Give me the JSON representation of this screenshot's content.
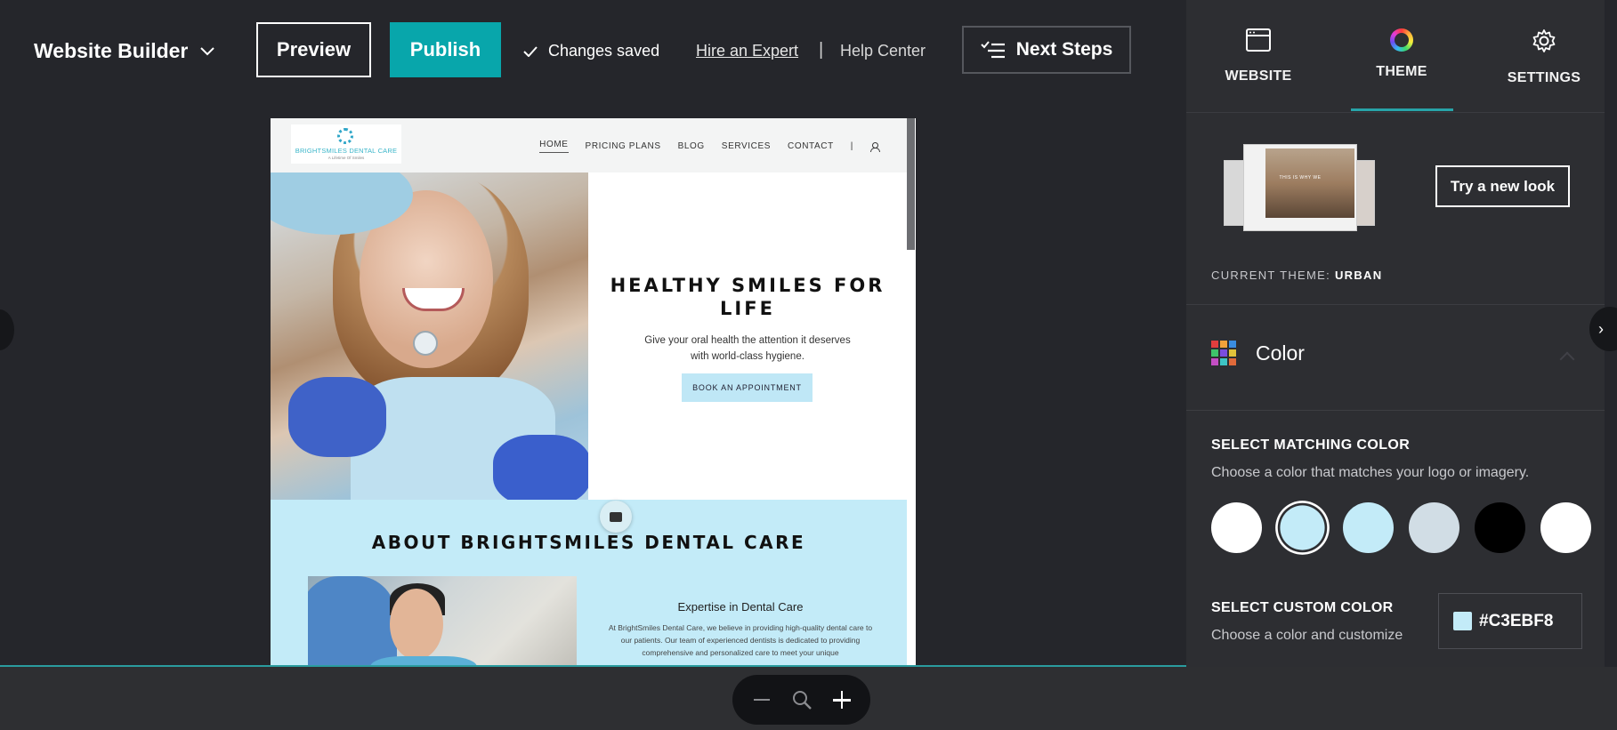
{
  "topbar": {
    "app_name": "Website Builder",
    "preview_label": "Preview",
    "publish_label": "Publish",
    "saved_status": "Changes saved",
    "hire_link": "Hire an Expert",
    "separator": "|",
    "help_link": "Help Center",
    "next_steps_label": "Next Steps"
  },
  "colors": {
    "background": "#25262b",
    "panel": "#2d2e32",
    "accent_teal": "#08a6ab",
    "tab_underline": "#27a3a8",
    "selected_custom": "#C3EBF8"
  },
  "site": {
    "logo_name": "BRIGHTSMILES DENTAL CARE",
    "logo_tagline": "A Lifetime Of Smiles",
    "menu": [
      "HOME",
      "PRICING PLANS",
      "BLOG",
      "SERVICES",
      "CONTACT"
    ],
    "menu_divider": "|",
    "hero": {
      "title": "HEALTHY SMILES FOR LIFE",
      "subtitle": "Give your oral health the attention it deserves with world-class hygiene.",
      "cta": "BOOK AN APPOINTMENT"
    },
    "about": {
      "title": "ABOUT BRIGHTSMILES DENTAL CARE",
      "heading": "Expertise in Dental Care",
      "body": "At BrightSmiles Dental Care, we believe in providing high-quality dental care to our patients. Our team of experienced dentists is dedicated to providing comprehensive and personalized care to meet your unique"
    }
  },
  "zoom": {
    "minus_icon": "minus-icon",
    "search_icon": "zoom-icon",
    "plus_icon": "plus-icon"
  },
  "panel": {
    "tabs": [
      {
        "label": "WEBSITE",
        "icon": "browser-window-icon"
      },
      {
        "label": "THEME",
        "icon": "color-ring-icon"
      },
      {
        "label": "SETTINGS",
        "icon": "gear-icon"
      }
    ],
    "active_tab": "THEME",
    "theme_preview_text": "THIS IS WHY WE",
    "try_new_look": "Try a new look",
    "current_theme_label": "CURRENT THEME:",
    "current_theme_name": "URBAN",
    "color_section_title": "Color",
    "select_matching_title": "SELECT MATCHING COLOR",
    "select_matching_desc": "Choose a color that matches your logo or imagery.",
    "swatches": [
      "#ffffff",
      "#c3ebf8",
      "#c3ebf8",
      "#d1dde5",
      "#000000",
      "#ffffff"
    ],
    "selected_swatch_index": 1,
    "custom_title": "SELECT CUSTOM COLOR",
    "custom_desc": "Choose a color and customize",
    "custom_value": "#C3EBF8"
  }
}
